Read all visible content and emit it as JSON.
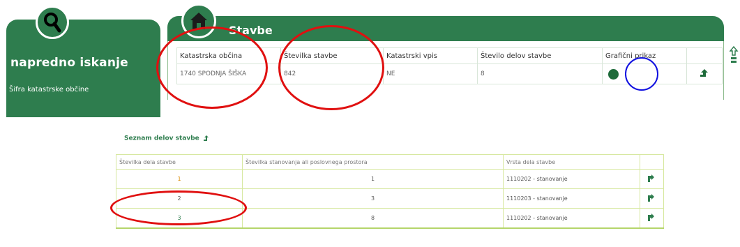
{
  "left_panel": {
    "title": "napredno iskanje",
    "subfield_label": "Šifra katastrske občine",
    "icon": "search-icon"
  },
  "stavbe": {
    "title": "Stavbe",
    "icon": "house-icon",
    "columns": [
      "Katastrska občina",
      "Številka stavbe",
      "Katastrski vpis",
      "Število delov stavbe",
      "Grafični prikaz",
      ""
    ],
    "row": {
      "obcina": "1740 SPODNJA ŠIŠKA",
      "stevilka": "842",
      "vpis": "NE",
      "stevilo_delov": "8",
      "graficni_icon": "globe-icon",
      "action_icon": "up-arrow-icon"
    }
  },
  "delitev": {
    "title": "Seznam delov stavbe",
    "columns": [
      "Številka dela stavbe",
      "Številka stanovanja ali poslovnega prostora",
      "Vrsta dela stavbe",
      ""
    ],
    "rows": [
      {
        "del": "1",
        "stanovanje": "1",
        "vrsta": "1110202 - stanovanje",
        "icon": "arrow-icon"
      },
      {
        "del": "2",
        "stanovanje": "3",
        "vrsta": "1110203 - stanovanje",
        "icon": "arrow-icon"
      },
      {
        "del": "3",
        "stanovanje": "8",
        "vrsta": "1110202 - stanovanje",
        "icon": "arrow-icon"
      }
    ]
  },
  "colors": {
    "green": "#2e7d4e",
    "annotation_red": "#e01010",
    "annotation_blue": "#1010e0"
  }
}
